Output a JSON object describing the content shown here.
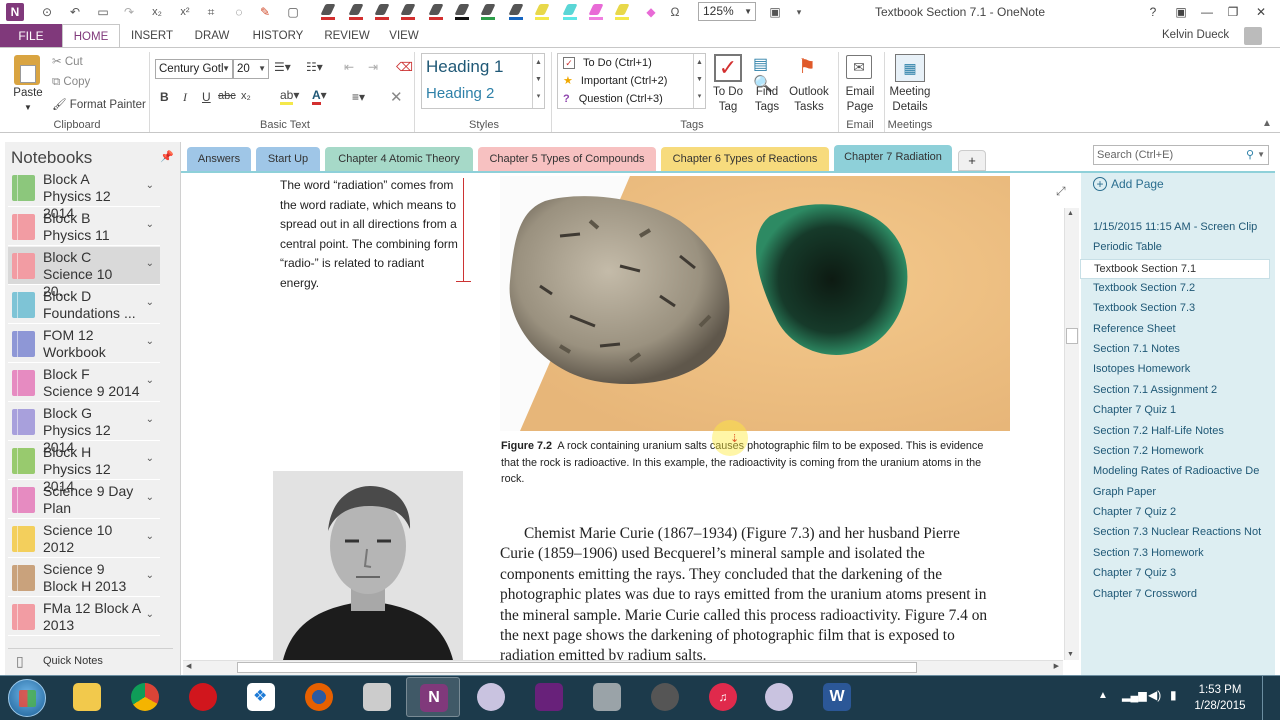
{
  "window": {
    "title": "Textbook Section 7.1 - OneNote",
    "zoom": "125%",
    "user": "Kelvin Dueck"
  },
  "ribbon": {
    "tabs": [
      "FILE",
      "HOME",
      "INSERT",
      "DRAW",
      "HISTORY",
      "REVIEW",
      "VIEW"
    ],
    "active_tab": "HOME",
    "clipboard": {
      "paste": "Paste",
      "cut": "Cut",
      "copy": "Copy",
      "format_painter": "Format Painter",
      "label": "Clipboard"
    },
    "basic_text": {
      "font": "Century Gotl",
      "size": "20",
      "label": "Basic Text",
      "bold": "B",
      "italic": "I",
      "underline": "U",
      "strike": "abc",
      "subscript": "x₂"
    },
    "styles": {
      "heading1": "Heading 1",
      "heading2": "Heading 2",
      "label": "Styles"
    },
    "tags": {
      "items": [
        "To Do (Ctrl+1)",
        "Important (Ctrl+2)",
        "Question (Ctrl+3)"
      ],
      "label": "Tags",
      "todo": "To Do Tag",
      "find": "Find Tags",
      "outlook": "Outlook Tasks"
    },
    "email": {
      "button": "Email Page",
      "label": "Email"
    },
    "meetings": {
      "button": "Meeting Details",
      "label": "Meetings"
    }
  },
  "notebooks": {
    "title": "Notebooks",
    "items": [
      {
        "name": "Block A Physics 12 2014",
        "color": "#8cc77c"
      },
      {
        "name": "Block B Physics 11 2014",
        "color": "#f29ca3"
      },
      {
        "name": "Block C Science 10 20...",
        "color": "#f29ca3"
      },
      {
        "name": "Block D Foundations ...",
        "color": "#7ec4d6"
      },
      {
        "name": "FOM 12 Workbook",
        "color": "#8e97d6"
      },
      {
        "name": "Block F Science 9 2014",
        "color": "#e68bc1"
      },
      {
        "name": "Block G Physics 12 2014",
        "color": "#a8a0dc"
      },
      {
        "name": "Block H Physics 12 2014",
        "color": "#98ca6e"
      },
      {
        "name": "Science 9 Day Plan",
        "color": "#e68bc1"
      },
      {
        "name": "Science 10 2012",
        "color": "#f3cf5c"
      },
      {
        "name": "Science 9 Block H 2013",
        "color": "#c9a27c"
      },
      {
        "name": "FMa 12 Block A 2013",
        "color": "#f29ca3"
      }
    ],
    "quick_notes": "Quick Notes"
  },
  "sections": [
    {
      "label": "Answers",
      "color": "#9fc6e7"
    },
    {
      "label": "Start Up",
      "color": "#9fc6e7"
    },
    {
      "label": "Chapter 4 Atomic Theory",
      "color": "#a6d9c8"
    },
    {
      "label": "Chapter 5 Types of Compounds",
      "color": "#f7c1c1"
    },
    {
      "label": "Chapter 6 Types of Reactions",
      "color": "#f7db7d"
    },
    {
      "label": "Chapter 7 Radiation",
      "color": "#8ed0d9"
    }
  ],
  "search": {
    "placeholder": "Search (Ctrl+E)"
  },
  "pages": {
    "add_page": "Add Page",
    "items": [
      "1/15/2015 11:15 AM - Screen Clip",
      "Periodic Table",
      "Textbook Section 7.1",
      "Textbook Section 7.2",
      "Textbook Section 7.3",
      "Reference Sheet",
      "Section 7.1 Notes",
      "Isotopes Homework",
      "Section 7.1 Assignment 2",
      "Chapter 7 Quiz 1",
      "Section 7.2 Half-Life Notes",
      "Section 7.2 Homework",
      "Modeling Rates of Radioactive De",
      "Graph Paper",
      "Chapter 7 Quiz 2",
      "Section 7.3 Nuclear Reactions Not",
      "Section 7.3 Homework",
      "Chapter 7 Quiz 3",
      "Chapter 7 Crossword"
    ],
    "selected_index": 2
  },
  "content": {
    "sidenote": "The word “radiation” comes from the word radiate, which means to spread out in all directions from a central point. The combining form “radio-” is related to radiant energy.",
    "figure_label": "Figure 7.2",
    "caption": "A rock containing uranium salts causes photographic film to be exposed. This is evidence that the rock is radioactive. In this example, the radioactivity is coming from the uranium atoms in the rock.",
    "body": "Chemist Marie Curie (1867–1934) (Figure 7.3) and her husband Pierre Curie (1859–1906) used Becquerel’s mineral sample and isolated the components emitting the rays. They concluded that the darkening of the photographic plates was due to rays emitted from the uranium atoms present in the mineral sample. Marie Curie called this process radioactivity. Figure 7.4 on the next page shows the darkening of photographic film that is exposed to radiation emitted by radium salts."
  },
  "taskbar": {
    "time": "1:53 PM",
    "date": "1/28/2015"
  }
}
